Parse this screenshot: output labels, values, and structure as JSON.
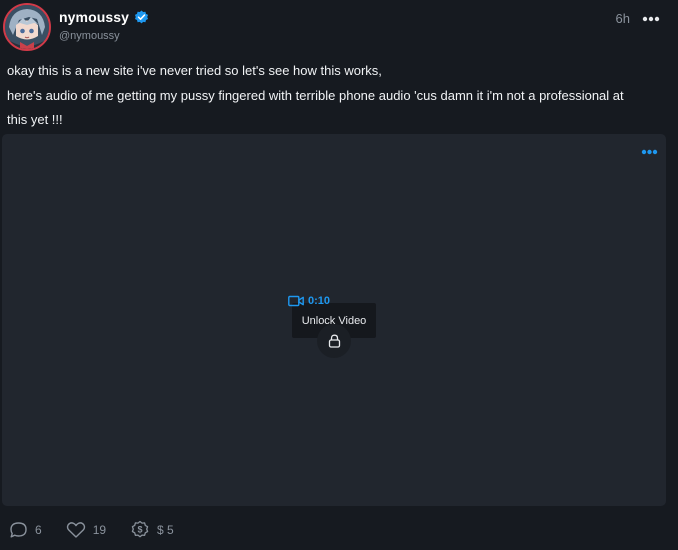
{
  "post": {
    "author": {
      "display_name": "nymoussy",
      "handle": "@nymoussy",
      "verified": true,
      "avatar_icon": "avatar-anime-character"
    },
    "time": "6h",
    "more_icon": "more-horizontal-icon",
    "text_lines": [
      "okay this is a new site i've never tried so let's see how this works,",
      "here's audio of me getting my pussy fingered with terrible phone audio 'cus damn it i'm not a professional at",
      "this yet !!!"
    ]
  },
  "media": {
    "type": "video",
    "duration": "0:10",
    "tooltip": "Unlock Video",
    "locked": true,
    "icons": {
      "video": "video-camera-icon",
      "lock": "lock-icon",
      "more": "more-horizontal-icon"
    }
  },
  "actions": {
    "comments": {
      "icon": "comment-icon",
      "count": "6"
    },
    "likes": {
      "icon": "heart-icon",
      "count": "19"
    },
    "tips": {
      "icon": "dollar-coin-icon",
      "amount": "$ 5"
    }
  },
  "colors": {
    "background": "#161a20",
    "media_background": "#21262e",
    "accent": "#1e98f0",
    "muted_text": "#8a929c",
    "avatar_ring": "#d13a48"
  }
}
